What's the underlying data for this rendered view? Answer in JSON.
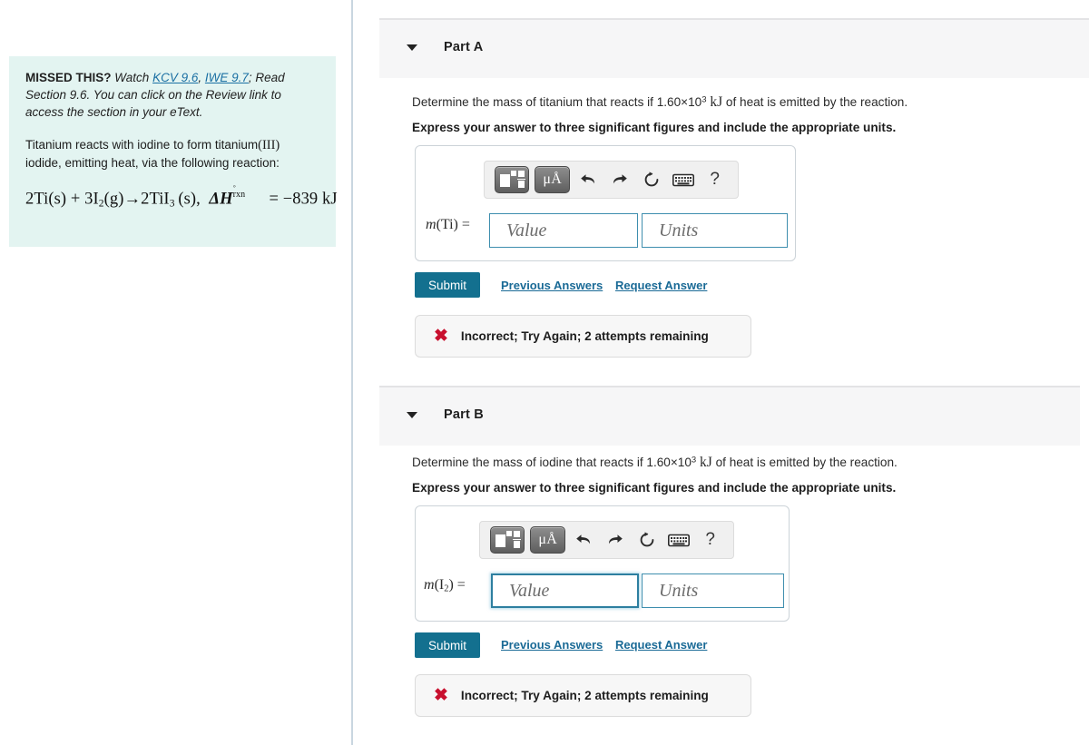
{
  "hint": {
    "prefix_bold": "MISSED THIS?",
    "watch_word": "Watch",
    "link1": "KCV 9.6",
    "comma": ",",
    "link2": "IWE 9.7",
    "tail": "; Read Section 9.6. You can click on the Review link to access the section in your eText.",
    "paragraph_part1": "Titanium reacts with iodine to form titanium",
    "paragraph_roman": "(III)",
    "paragraph_part2": "iodide, emitting heat, via the following reaction:",
    "equation": "2Ti(s) + 3I2(g)→2TiI3(s), ΔH°rxn = −839 kJ",
    "bg_color": "#e3f4f1"
  },
  "toolbar": {
    "template_button": "math-template",
    "unit_button": "μÅ",
    "undo": "undo",
    "redo": "redo",
    "reset": "reset",
    "keyboard": "keyboard",
    "help": "?"
  },
  "parts": [
    {
      "id": "part-a",
      "title": "Part A",
      "question_pre": "Determine the mass of titanium that reacts if 1.60×10",
      "question_exp": "3",
      "question_unit": "kJ",
      "question_post": "of heat is emitted by the reaction.",
      "instruction": "Express your answer to three significant figures and include the appropriate units.",
      "answer_label_m": "m",
      "answer_label_paren_open": "(Ti)",
      "answer_label_eq": "=",
      "value_placeholder": "Value",
      "units_placeholder": "Units",
      "value_focused": false,
      "submit_label": "Submit",
      "previous_answers_label": "Previous Answers",
      "request_answer_label": "Request Answer",
      "feedback_icon": "✖",
      "feedback_text": "Incorrect; Try Again; 2 attempts remaining"
    },
    {
      "id": "part-b",
      "title": "Part B",
      "question_pre": "Determine the mass of iodine that reacts if 1.60×10",
      "question_exp": "3",
      "question_unit": "kJ",
      "question_post": "of heat is emitted by the reaction.",
      "instruction": "Express your answer to three significant figures and include the appropriate units.",
      "answer_label_m": "m",
      "answer_label_paren_open": "(I",
      "answer_label_sub": "2",
      "answer_label_paren_close": ")",
      "answer_label_eq": "=",
      "value_placeholder": "Value",
      "units_placeholder": "Units",
      "value_focused": true,
      "submit_label": "Submit",
      "previous_answers_label": "Previous Answers",
      "request_answer_label": "Request Answer",
      "feedback_icon": "✖",
      "feedback_text": "Incorrect; Try Again; 2 attempts remaining"
    }
  ],
  "colors": {
    "accent": "#13708f",
    "link": "#1a6a96",
    "error": "#c8102e",
    "panel": "#f6f6f7",
    "hint": "#e3f4f1"
  }
}
